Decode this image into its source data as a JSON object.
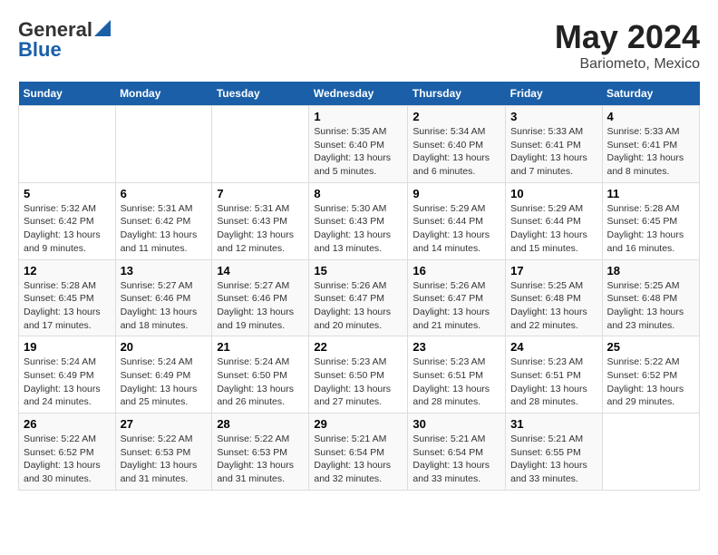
{
  "logo": {
    "general": "General",
    "blue": "Blue"
  },
  "title": "May 2024",
  "subtitle": "Bariometo, Mexico",
  "days_of_week": [
    "Sunday",
    "Monday",
    "Tuesday",
    "Wednesday",
    "Thursday",
    "Friday",
    "Saturday"
  ],
  "weeks": [
    [
      {
        "day": "",
        "info": ""
      },
      {
        "day": "",
        "info": ""
      },
      {
        "day": "",
        "info": ""
      },
      {
        "day": "1",
        "info": "Sunrise: 5:35 AM\nSunset: 6:40 PM\nDaylight: 13 hours\nand 5 minutes."
      },
      {
        "day": "2",
        "info": "Sunrise: 5:34 AM\nSunset: 6:40 PM\nDaylight: 13 hours\nand 6 minutes."
      },
      {
        "day": "3",
        "info": "Sunrise: 5:33 AM\nSunset: 6:41 PM\nDaylight: 13 hours\nand 7 minutes."
      },
      {
        "day": "4",
        "info": "Sunrise: 5:33 AM\nSunset: 6:41 PM\nDaylight: 13 hours\nand 8 minutes."
      }
    ],
    [
      {
        "day": "5",
        "info": "Sunrise: 5:32 AM\nSunset: 6:42 PM\nDaylight: 13 hours\nand 9 minutes."
      },
      {
        "day": "6",
        "info": "Sunrise: 5:31 AM\nSunset: 6:42 PM\nDaylight: 13 hours\nand 11 minutes."
      },
      {
        "day": "7",
        "info": "Sunrise: 5:31 AM\nSunset: 6:43 PM\nDaylight: 13 hours\nand 12 minutes."
      },
      {
        "day": "8",
        "info": "Sunrise: 5:30 AM\nSunset: 6:43 PM\nDaylight: 13 hours\nand 13 minutes."
      },
      {
        "day": "9",
        "info": "Sunrise: 5:29 AM\nSunset: 6:44 PM\nDaylight: 13 hours\nand 14 minutes."
      },
      {
        "day": "10",
        "info": "Sunrise: 5:29 AM\nSunset: 6:44 PM\nDaylight: 13 hours\nand 15 minutes."
      },
      {
        "day": "11",
        "info": "Sunrise: 5:28 AM\nSunset: 6:45 PM\nDaylight: 13 hours\nand 16 minutes."
      }
    ],
    [
      {
        "day": "12",
        "info": "Sunrise: 5:28 AM\nSunset: 6:45 PM\nDaylight: 13 hours\nand 17 minutes."
      },
      {
        "day": "13",
        "info": "Sunrise: 5:27 AM\nSunset: 6:46 PM\nDaylight: 13 hours\nand 18 minutes."
      },
      {
        "day": "14",
        "info": "Sunrise: 5:27 AM\nSunset: 6:46 PM\nDaylight: 13 hours\nand 19 minutes."
      },
      {
        "day": "15",
        "info": "Sunrise: 5:26 AM\nSunset: 6:47 PM\nDaylight: 13 hours\nand 20 minutes."
      },
      {
        "day": "16",
        "info": "Sunrise: 5:26 AM\nSunset: 6:47 PM\nDaylight: 13 hours\nand 21 minutes."
      },
      {
        "day": "17",
        "info": "Sunrise: 5:25 AM\nSunset: 6:48 PM\nDaylight: 13 hours\nand 22 minutes."
      },
      {
        "day": "18",
        "info": "Sunrise: 5:25 AM\nSunset: 6:48 PM\nDaylight: 13 hours\nand 23 minutes."
      }
    ],
    [
      {
        "day": "19",
        "info": "Sunrise: 5:24 AM\nSunset: 6:49 PM\nDaylight: 13 hours\nand 24 minutes."
      },
      {
        "day": "20",
        "info": "Sunrise: 5:24 AM\nSunset: 6:49 PM\nDaylight: 13 hours\nand 25 minutes."
      },
      {
        "day": "21",
        "info": "Sunrise: 5:24 AM\nSunset: 6:50 PM\nDaylight: 13 hours\nand 26 minutes."
      },
      {
        "day": "22",
        "info": "Sunrise: 5:23 AM\nSunset: 6:50 PM\nDaylight: 13 hours\nand 27 minutes."
      },
      {
        "day": "23",
        "info": "Sunrise: 5:23 AM\nSunset: 6:51 PM\nDaylight: 13 hours\nand 28 minutes."
      },
      {
        "day": "24",
        "info": "Sunrise: 5:23 AM\nSunset: 6:51 PM\nDaylight: 13 hours\nand 28 minutes."
      },
      {
        "day": "25",
        "info": "Sunrise: 5:22 AM\nSunset: 6:52 PM\nDaylight: 13 hours\nand 29 minutes."
      }
    ],
    [
      {
        "day": "26",
        "info": "Sunrise: 5:22 AM\nSunset: 6:52 PM\nDaylight: 13 hours\nand 30 minutes."
      },
      {
        "day": "27",
        "info": "Sunrise: 5:22 AM\nSunset: 6:53 PM\nDaylight: 13 hours\nand 31 minutes."
      },
      {
        "day": "28",
        "info": "Sunrise: 5:22 AM\nSunset: 6:53 PM\nDaylight: 13 hours\nand 31 minutes."
      },
      {
        "day": "29",
        "info": "Sunrise: 5:21 AM\nSunset: 6:54 PM\nDaylight: 13 hours\nand 32 minutes."
      },
      {
        "day": "30",
        "info": "Sunrise: 5:21 AM\nSunset: 6:54 PM\nDaylight: 13 hours\nand 33 minutes."
      },
      {
        "day": "31",
        "info": "Sunrise: 5:21 AM\nSunset: 6:55 PM\nDaylight: 13 hours\nand 33 minutes."
      },
      {
        "day": "",
        "info": ""
      }
    ]
  ]
}
